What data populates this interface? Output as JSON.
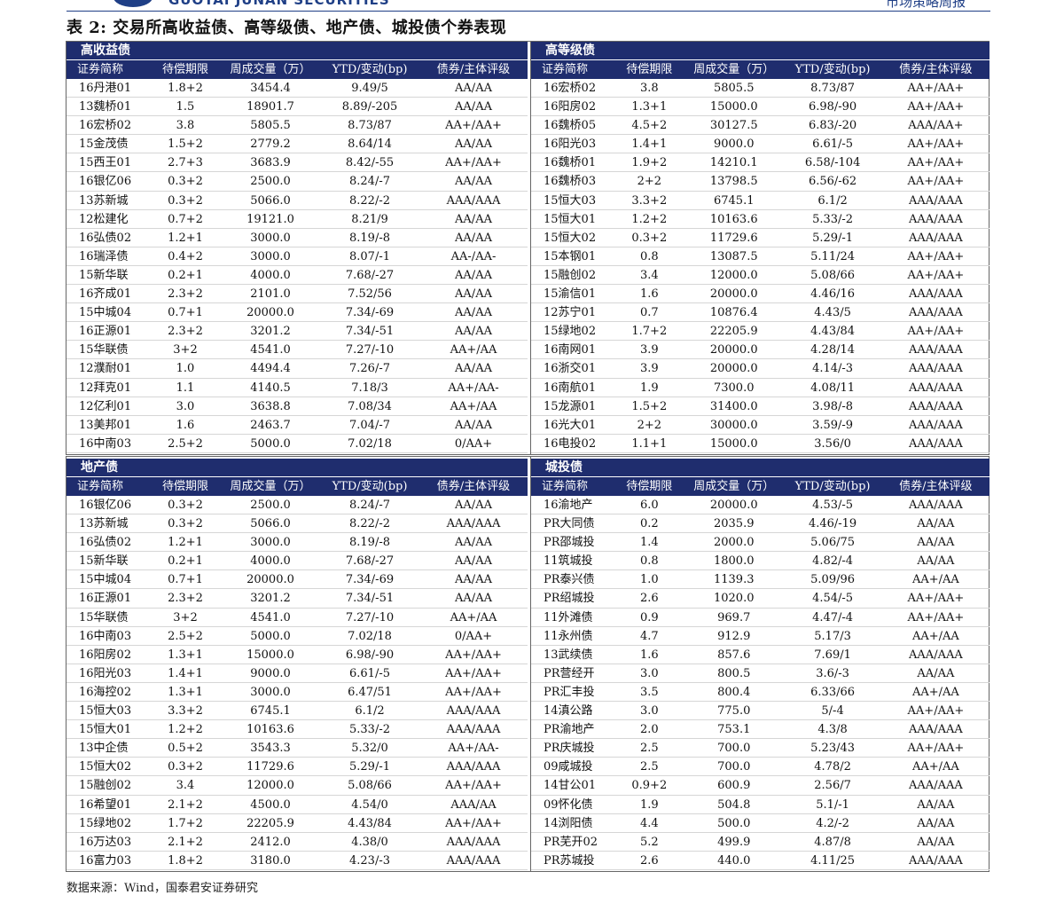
{
  "header": {
    "logo_text": "GUOTAI JUNAN SECURITIES",
    "report_name": "市场策略周报"
  },
  "title": "表 2:  交易所高收益债、高等级债、地产债、城投债个券表现",
  "columns": [
    "证券简称",
    "待偿期限",
    "周成交量（万）",
    "YTD/变动(bp)",
    "债券/主体评级"
  ],
  "panels": {
    "high_yield": {
      "title": "高收益债",
      "rows": [
        [
          "16丹港01",
          "1.8+2",
          "3454.4",
          "9.49/5",
          "AA/AA"
        ],
        [
          "13魏桥01",
          "1.5",
          "18901.7",
          "8.89/-205",
          "AA/AA"
        ],
        [
          "16宏桥02",
          "3.8",
          "5805.5",
          "8.73/87",
          "AA+/AA+"
        ],
        [
          "15金茂债",
          "1.5+2",
          "2779.2",
          "8.64/14",
          "AA/AA"
        ],
        [
          "15西王01",
          "2.7+3",
          "3683.9",
          "8.42/-55",
          "AA+/AA+"
        ],
        [
          "16银亿06",
          "0.3+2",
          "2500.0",
          "8.24/-7",
          "AA/AA"
        ],
        [
          "13苏新城",
          "0.3+2",
          "5066.0",
          "8.22/-2",
          "AAA/AAA"
        ],
        [
          "12松建化",
          "0.7+2",
          "19121.0",
          "8.21/9",
          "AA/AA"
        ],
        [
          "16弘债02",
          "1.2+1",
          "3000.0",
          "8.19/-8",
          "AA/AA"
        ],
        [
          "16瑞泽债",
          "0.4+2",
          "3000.0",
          "8.07/-1",
          "AA-/AA-"
        ],
        [
          "15新华联",
          "0.2+1",
          "4000.0",
          "7.68/-27",
          "AA/AA"
        ],
        [
          "16齐成01",
          "2.3+2",
          "2101.0",
          "7.52/56",
          "AA/AA"
        ],
        [
          "15中城04",
          "0.7+1",
          "20000.0",
          "7.34/-69",
          "AA/AA"
        ],
        [
          "16正源01",
          "2.3+2",
          "3201.2",
          "7.34/-51",
          "AA/AA"
        ],
        [
          "15华联债",
          "3+2",
          "4541.0",
          "7.27/-10",
          "AA+/AA"
        ],
        [
          "12濮耐01",
          "1.0",
          "4494.4",
          "7.26/-7",
          "AA/AA"
        ],
        [
          "12拜克01",
          "1.1",
          "4140.5",
          "7.18/3",
          "AA+/AA-"
        ],
        [
          "12亿利01",
          "3.0",
          "3638.8",
          "7.08/34",
          "AA+/AA"
        ],
        [
          "13美邦01",
          "1.6",
          "2463.7",
          "7.04/-7",
          "AA/AA"
        ],
        [
          "16中南03",
          "2.5+2",
          "5000.0",
          "7.02/18",
          "0/AA+"
        ]
      ]
    },
    "high_grade": {
      "title": "高等级债",
      "rows": [
        [
          "16宏桥02",
          "3.8",
          "5805.5",
          "8.73/87",
          "AA+/AA+"
        ],
        [
          "16阳房02",
          "1.3+1",
          "15000.0",
          "6.98/-90",
          "AA+/AA+"
        ],
        [
          "16魏桥05",
          "4.5+2",
          "30127.5",
          "6.83/-20",
          "AAA/AA+"
        ],
        [
          "16阳光03",
          "1.4+1",
          "9000.0",
          "6.61/-5",
          "AA+/AA+"
        ],
        [
          "16魏桥01",
          "1.9+2",
          "14210.1",
          "6.58/-104",
          "AA+/AA+"
        ],
        [
          "16魏桥03",
          "2+2",
          "13798.5",
          "6.56/-62",
          "AA+/AA+"
        ],
        [
          "15恒大03",
          "3.3+2",
          "6745.1",
          "6.1/2",
          "AAA/AAA"
        ],
        [
          "15恒大01",
          "1.2+2",
          "10163.6",
          "5.33/-2",
          "AAA/AAA"
        ],
        [
          "15恒大02",
          "0.3+2",
          "11729.6",
          "5.29/-1",
          "AAA/AAA"
        ],
        [
          "15本钢01",
          "0.8",
          "13087.5",
          "5.11/24",
          "AA+/AA+"
        ],
        [
          "15融创02",
          "3.4",
          "12000.0",
          "5.08/66",
          "AA+/AA+"
        ],
        [
          "15渝信01",
          "1.6",
          "20000.0",
          "4.46/16",
          "AAA/AAA"
        ],
        [
          "12苏宁01",
          "0.7",
          "10876.4",
          "4.43/5",
          "AAA/AAA"
        ],
        [
          "15绿地02",
          "1.7+2",
          "22205.9",
          "4.43/84",
          "AA+/AA+"
        ],
        [
          "16南网01",
          "3.9",
          "20000.0",
          "4.28/14",
          "AAA/AAA"
        ],
        [
          "16浙交01",
          "3.9",
          "20000.0",
          "4.14/-3",
          "AAA/AAA"
        ],
        [
          "16南航01",
          "1.9",
          "7300.0",
          "4.08/11",
          "AAA/AAA"
        ],
        [
          "15龙源01",
          "1.5+2",
          "31400.0",
          "3.98/-8",
          "AAA/AAA"
        ],
        [
          "16光大01",
          "2+2",
          "30000.0",
          "3.59/-9",
          "AAA/AAA"
        ],
        [
          "16电投02",
          "1.1+1",
          "15000.0",
          "3.56/0",
          "AAA/AAA"
        ]
      ]
    },
    "real_estate": {
      "title": "地产债",
      "rows": [
        [
          "16银亿06",
          "0.3+2",
          "2500.0",
          "8.24/-7",
          "AA/AA"
        ],
        [
          "13苏新城",
          "0.3+2",
          "5066.0",
          "8.22/-2",
          "AAA/AAA"
        ],
        [
          "16弘债02",
          "1.2+1",
          "3000.0",
          "8.19/-8",
          "AA/AA"
        ],
        [
          "15新华联",
          "0.2+1",
          "4000.0",
          "7.68/-27",
          "AA/AA"
        ],
        [
          "15中城04",
          "0.7+1",
          "20000.0",
          "7.34/-69",
          "AA/AA"
        ],
        [
          "16正源01",
          "2.3+2",
          "3201.2",
          "7.34/-51",
          "AA/AA"
        ],
        [
          "15华联债",
          "3+2",
          "4541.0",
          "7.27/-10",
          "AA+/AA"
        ],
        [
          "16中南03",
          "2.5+2",
          "5000.0",
          "7.02/18",
          "0/AA+"
        ],
        [
          "16阳房02",
          "1.3+1",
          "15000.0",
          "6.98/-90",
          "AA+/AA+"
        ],
        [
          "16阳光03",
          "1.4+1",
          "9000.0",
          "6.61/-5",
          "AA+/AA+"
        ],
        [
          "16海控02",
          "1.3+1",
          "3000.0",
          "6.47/51",
          "AA+/AA+"
        ],
        [
          "15恒大03",
          "3.3+2",
          "6745.1",
          "6.1/2",
          "AAA/AAA"
        ],
        [
          "15恒大01",
          "1.2+2",
          "10163.6",
          "5.33/-2",
          "AAA/AAA"
        ],
        [
          "13中企债",
          "0.5+2",
          "3543.3",
          "5.32/0",
          "AA+/AA-"
        ],
        [
          "15恒大02",
          "0.3+2",
          "11729.6",
          "5.29/-1",
          "AAA/AAA"
        ],
        [
          "15融创02",
          "3.4",
          "12000.0",
          "5.08/66",
          "AA+/AA+"
        ],
        [
          "16希望01",
          "2.1+2",
          "4500.0",
          "4.54/0",
          "AAA/AA"
        ],
        [
          "15绿地02",
          "1.7+2",
          "22205.9",
          "4.43/84",
          "AA+/AA+"
        ],
        [
          "16万达03",
          "2.1+2",
          "2412.0",
          "4.38/0",
          "AAA/AAA"
        ],
        [
          "16富力03",
          "1.8+2",
          "3180.0",
          "4.23/-3",
          "AAA/AAA"
        ]
      ]
    },
    "chengtou": {
      "title": "城投债",
      "rows": [
        [
          "16渝地产",
          "6.0",
          "20000.0",
          "4.53/-5",
          "AAA/AAA"
        ],
        [
          "PR大同债",
          "0.2",
          "2035.9",
          "4.46/-19",
          "AA/AA"
        ],
        [
          "PR邵城投",
          "1.4",
          "2000.0",
          "5.06/75",
          "AA/AA"
        ],
        [
          "11筑城投",
          "0.8",
          "1800.0",
          "4.82/-4",
          "AA/AA"
        ],
        [
          "PR泰兴债",
          "1.0",
          "1139.3",
          "5.09/96",
          "AA+/AA"
        ],
        [
          "PR绍城投",
          "2.6",
          "1020.0",
          "4.54/-5",
          "AA+/AA+"
        ],
        [
          "11外滩债",
          "0.9",
          "969.7",
          "4.47/-4",
          "AA+/AA+"
        ],
        [
          "11永州债",
          "4.7",
          "912.9",
          "5.17/3",
          "AA+/AA"
        ],
        [
          "13武续债",
          "1.6",
          "857.6",
          "7.69/1",
          "AAA/AAA"
        ],
        [
          "PR营经开",
          "3.0",
          "800.5",
          "3.6/-3",
          "AA/AA"
        ],
        [
          "PR汇丰投",
          "3.5",
          "800.4",
          "6.33/66",
          "AA+/AA"
        ],
        [
          "14滇公路",
          "3.0",
          "775.0",
          "5/-4",
          "AA+/AA+"
        ],
        [
          "PR渝地产",
          "2.0",
          "753.1",
          "4.3/8",
          "AAA/AAA"
        ],
        [
          "PR庆城投",
          "2.5",
          "700.0",
          "5.23/43",
          "AA+/AA+"
        ],
        [
          "09咸城投",
          "2.5",
          "700.0",
          "4.78/2",
          "AA+/AA"
        ],
        [
          "14甘公01",
          "0.9+2",
          "600.9",
          "2.56/7",
          "AAA/AAA"
        ],
        [
          "09怀化债",
          "1.9",
          "504.8",
          "5.1/-1",
          "AA/AA"
        ],
        [
          "14浏阳债",
          "4.4",
          "500.0",
          "4.2/-2",
          "AA/AA"
        ],
        [
          "PR芜开02",
          "5.2",
          "499.9",
          "4.87/8",
          "AA/AA"
        ],
        [
          "PR苏城投",
          "2.6",
          "440.0",
          "4.11/25",
          "AAA/AAA"
        ]
      ]
    }
  },
  "source": "数据来源：Wind，国泰君安证券研究"
}
